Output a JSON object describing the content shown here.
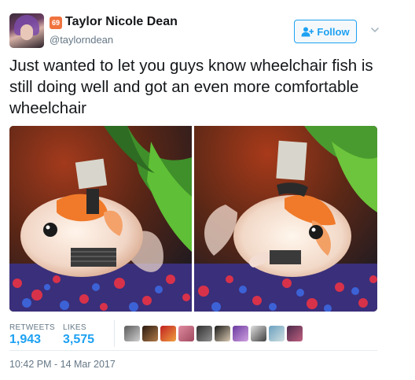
{
  "header": {
    "badge": "69",
    "display_name": "Taylor Nicole Dean",
    "handle": "@taylorndean",
    "follow_label": "Follow"
  },
  "tweet": {
    "text": "Just wanted to let you guys know wheelchair fish is still doing well and got an even more comfortable wheelchair",
    "timestamp": "10:42 PM - 14 Mar 2017"
  },
  "stats": {
    "retweets_label": "RETWEETS",
    "retweets_count": "1,943",
    "likes_label": "LIKES",
    "likes_count": "3,575"
  },
  "colors": {
    "accent": "#1da1f2",
    "muted_text": "#657786",
    "badge": "#f0733f"
  },
  "icons": [
    "follow-user-icon",
    "chevron-down-icon"
  ]
}
